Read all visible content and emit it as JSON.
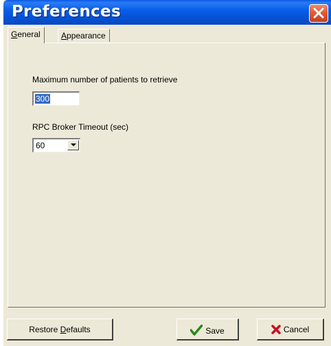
{
  "window": {
    "title": "Preferences"
  },
  "tabs": [
    {
      "prefix": "",
      "mnemonic": "G",
      "rest": "eneral",
      "active": true
    },
    {
      "prefix": "",
      "mnemonic": "A",
      "rest": "ppearance",
      "active": false
    }
  ],
  "general": {
    "max_patients_label": "Maximum number of patients to retrieve",
    "max_patients_value": "300",
    "timeout_label": "RPC Broker Timeout (sec)",
    "timeout_value": "60"
  },
  "buttons": {
    "restore_prefix": "Restore ",
    "restore_mnemonic": "D",
    "restore_rest": "efaults",
    "save_label": "Save",
    "cancel_label": "Cancel"
  },
  "icons": {
    "close": "close-icon",
    "save": "checkmark-icon",
    "cancel": "x-icon",
    "dropdown": "chevron-down-icon"
  },
  "colors": {
    "titlebar": "#0a5fe8",
    "close_button": "#e25a35",
    "selection": "#316ac5",
    "checkmark": "#2a8a1a",
    "cancel_x": "#c8101e",
    "dialog_bg": "#ece9d8"
  }
}
